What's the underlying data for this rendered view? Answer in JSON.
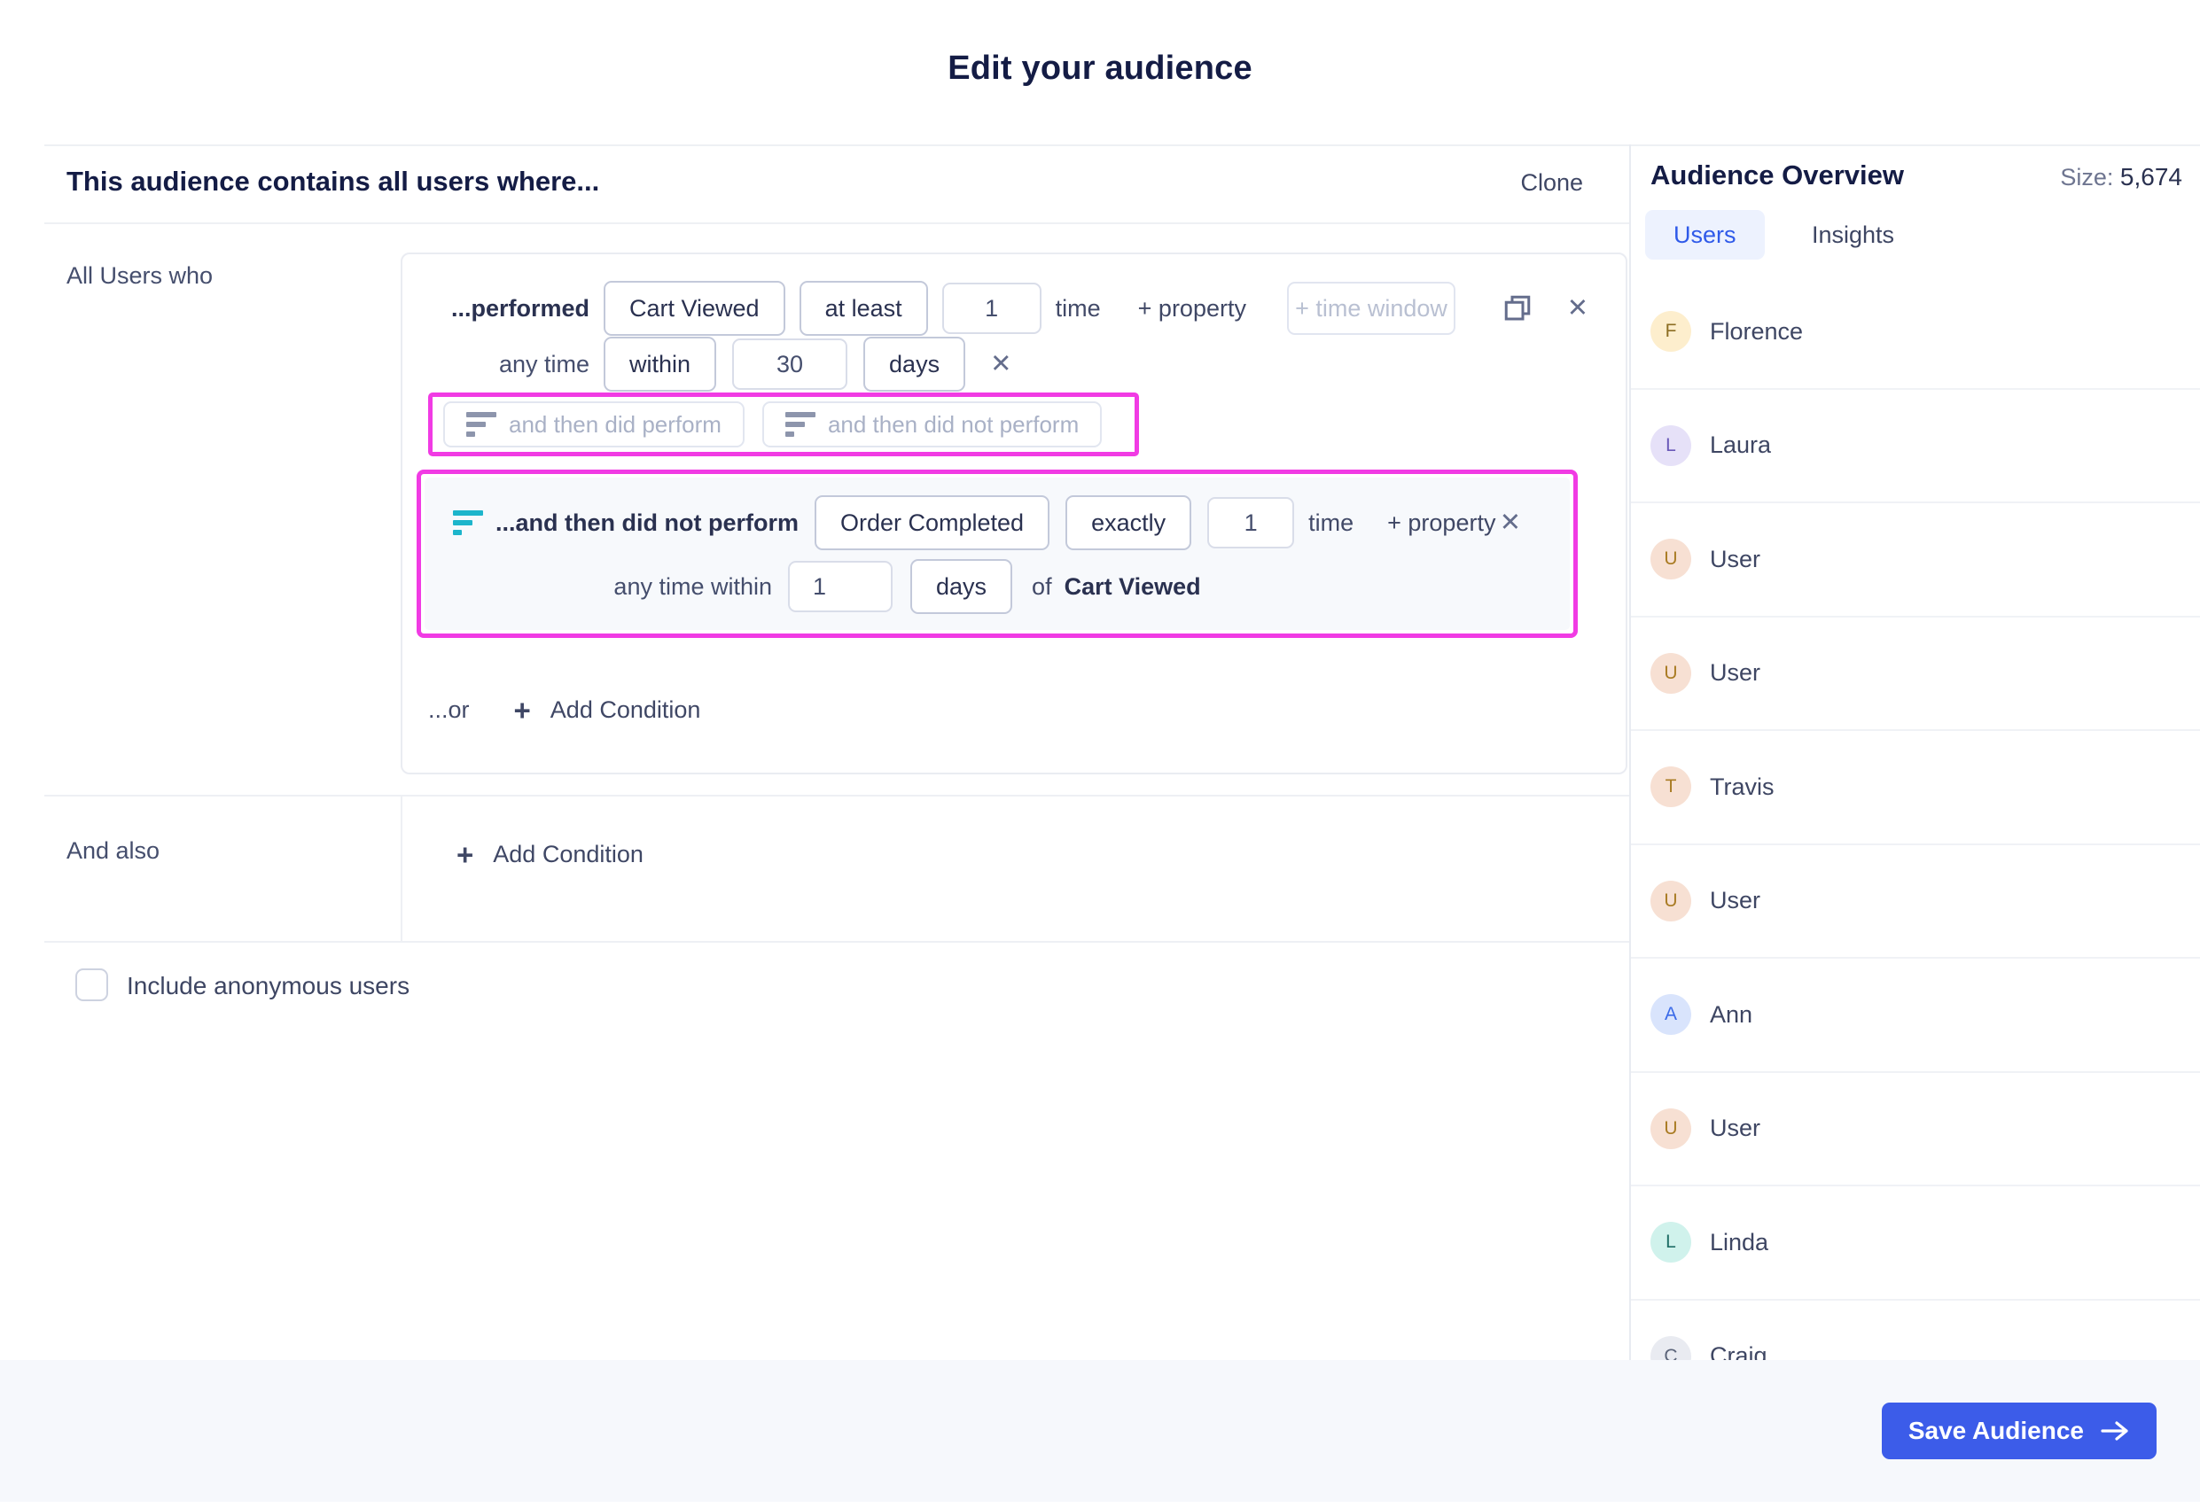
{
  "title": "Edit your audience",
  "main": {
    "header": {
      "title": "This audience contains all users where...",
      "clone": "Clone"
    },
    "who_label": "All Users who",
    "cond1": {
      "prefix": "...performed",
      "event": "Cart Viewed",
      "operator": "at least",
      "count": "1",
      "time_label": "time",
      "property_label": "+ property",
      "time_window_placeholder": "+ time window"
    },
    "cond1_time": {
      "prefix": "any time",
      "operator": "within",
      "value": "30",
      "unit": "days"
    },
    "then_actions": {
      "perform": "and then did perform",
      "not_perform": "and then did not perform"
    },
    "cond2": {
      "prefix": "...and then did not perform",
      "event": "Order Completed",
      "operator": "exactly",
      "count": "1",
      "time_label": "time",
      "property_label": "+ property",
      "window_prefix": "any time within",
      "window_value": "1",
      "window_unit": "days",
      "of_label": "of",
      "ref_event": "Cart Viewed"
    },
    "or_label": "...or",
    "add_condition": "Add Condition",
    "and_also": "And also",
    "add_condition2": "Add Condition",
    "anonymous_label": "Include anonymous users",
    "anonymous_checked": false
  },
  "sidebar": {
    "title": "Audience Overview",
    "size_label": "Size:",
    "size_value": "5,674",
    "tabs": {
      "users": "Users",
      "insights": "Insights"
    },
    "users": [
      {
        "name": "Florence",
        "initial": "F",
        "bg": "#fdeecd",
        "fg": "#8c6d22"
      },
      {
        "name": "Laura",
        "initial": "L",
        "bg": "#e6e1f8",
        "fg": "#6958b8"
      },
      {
        "name": "User",
        "initial": "U",
        "bg": "#f7e0d3",
        "fg": "#a97b23"
      },
      {
        "name": "User",
        "initial": "U",
        "bg": "#f7e0d3",
        "fg": "#a97b23"
      },
      {
        "name": "Travis",
        "initial": "T",
        "bg": "#f7e0d3",
        "fg": "#a97b23"
      },
      {
        "name": "User",
        "initial": "U",
        "bg": "#f7e0d3",
        "fg": "#a97b23"
      },
      {
        "name": "Ann",
        "initial": "A",
        "bg": "#d9e4fc",
        "fg": "#3a6ae8"
      },
      {
        "name": "User",
        "initial": "U",
        "bg": "#f7e0d3",
        "fg": "#a97b23"
      },
      {
        "name": "Linda",
        "initial": "L",
        "bg": "#d0f2ec",
        "fg": "#1f6e66"
      },
      {
        "name": "Craig",
        "initial": "C",
        "bg": "#e9ebf1",
        "fg": "#5a6378"
      }
    ]
  },
  "footer": {
    "save": "Save Audience"
  },
  "colors": {
    "highlight_magenta": "#f13be4",
    "teal_icon": "#1db5cb",
    "accent_blue": "#3c5ce9",
    "tab_blue": "#2f5ae9"
  }
}
